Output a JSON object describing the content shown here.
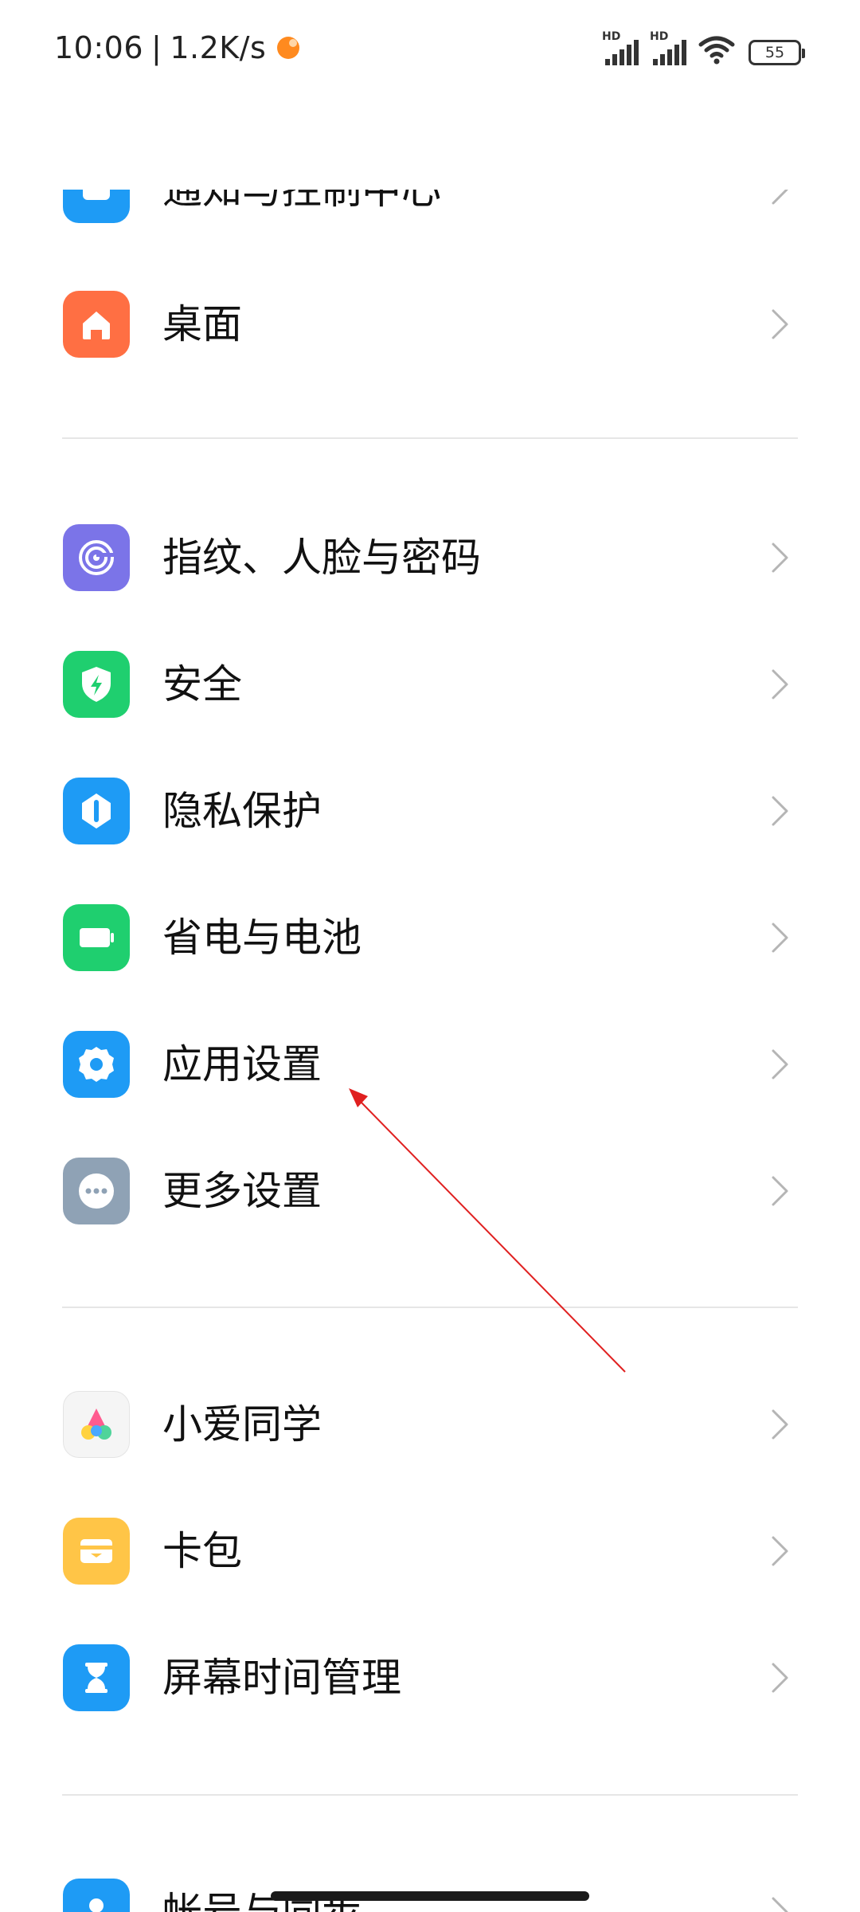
{
  "status_bar": {
    "time": "10:06",
    "separator": "|",
    "speed": "1.2K/s",
    "sim1_label": "HD",
    "sim2_label": "HD",
    "battery": "55"
  },
  "items": [
    {
      "label": "通知与控制中心",
      "icon": "notification-icon",
      "color": "#1e9bf5"
    },
    {
      "label": "桌面",
      "icon": "home-icon",
      "color": "#ff6f43"
    },
    {
      "label": "指纹、人脸与密码",
      "icon": "fingerprint-icon",
      "color": "#7b74e8"
    },
    {
      "label": "安全",
      "icon": "shield-icon",
      "color": "#1fcf6f"
    },
    {
      "label": "隐私保护",
      "icon": "privacy-icon",
      "color": "#1e9bf5"
    },
    {
      "label": "省电与电池",
      "icon": "battery-saver-icon",
      "color": "#1fcf6f"
    },
    {
      "label": "应用设置",
      "icon": "gear-icon",
      "color": "#1e9bf5"
    },
    {
      "label": "更多设置",
      "icon": "more-icon",
      "color": "#8fa2b5"
    },
    {
      "label": "小爱同学",
      "icon": "xiaoai-icon",
      "color": "#f5f5f5"
    },
    {
      "label": "卡包",
      "icon": "wallet-icon",
      "color": "#ffc547"
    },
    {
      "label": "屏幕时间管理",
      "icon": "hourglass-icon",
      "color": "#1e9bf5"
    },
    {
      "label": "帐号与同步",
      "icon": "account-icon",
      "color": "#1e9bf5"
    }
  ],
  "annotation_color": "#e02020"
}
